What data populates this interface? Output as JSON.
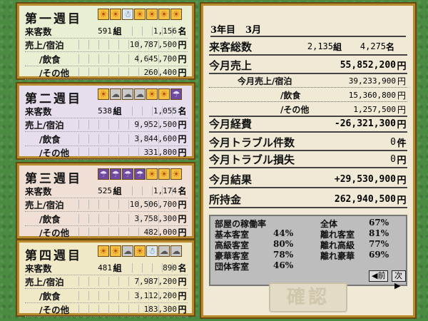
{
  "weeks": [
    {
      "title": "第一週目",
      "weather": [
        "sun",
        "sun",
        "snow",
        "sun",
        "sun",
        "sun",
        "sun"
      ],
      "rows": [
        [
          "来客数",
          "591",
          "組",
          "1,156",
          "名"
        ],
        [
          "売上/宿泊",
          "10,787,500",
          "円"
        ],
        [
          "/飲食",
          "4,645,700",
          "円"
        ],
        [
          "/その他",
          "260,400",
          "円"
        ]
      ]
    },
    {
      "title": "第二週目",
      "weather": [
        "sun",
        "cloud",
        "cloud",
        "cloud",
        "sun",
        "sun",
        "rain"
      ],
      "rows": [
        [
          "来客数",
          "538",
          "組",
          "1,055",
          "名"
        ],
        [
          "売上/宿泊",
          "9,952,500",
          "円"
        ],
        [
          "/飲食",
          "3,844,600",
          "円"
        ],
        [
          "/その他",
          "331,800",
          "円"
        ]
      ]
    },
    {
      "title": "第三週目",
      "weather": [
        "rain",
        "rain",
        "rain",
        "rain",
        "sun",
        "sun",
        "sun"
      ],
      "rows": [
        [
          "来客数",
          "525",
          "組",
          "1,174",
          "名"
        ],
        [
          "売上/宿泊",
          "10,506,700",
          "円"
        ],
        [
          "/飲食",
          "3,758,300",
          "円"
        ],
        [
          "/その他",
          "482,000",
          "円"
        ]
      ]
    },
    {
      "title": "第四週目",
      "weather": [
        "sun",
        "sun",
        "cloud",
        "sun",
        "snow",
        "cloud",
        "cloud"
      ],
      "rows": [
        [
          "来客数",
          "481",
          "組",
          "890",
          "名"
        ],
        [
          "売上/宿泊",
          "7,987,200",
          "円"
        ],
        [
          "/飲食",
          "3,112,200",
          "円"
        ],
        [
          "/その他",
          "183,300",
          "円"
        ]
      ]
    }
  ],
  "summary": {
    "year": "3年目",
    "month": "3月",
    "visitors_label": "来客総数",
    "visitors_groups": "2,135",
    "groups_unit": "組",
    "visitors_people": "4,275",
    "people_unit": "名",
    "sales_label": "今月売上",
    "sales": "55,852,200",
    "lodging_label": "今月売上/宿泊",
    "lodging": "39,233,900",
    "food_label": "/飲食",
    "food": "15,360,800",
    "other_label": "/その他",
    "other": "1,257,500",
    "expense_label": "今月経費",
    "expense": "-26,321,300",
    "trouble_count_label": "今月トラブル件数",
    "trouble_count": "0",
    "count_unit": "件",
    "trouble_loss_label": "今月トラブル損失",
    "trouble_loss": "0",
    "result_label": "今月結果",
    "result": "+29,530,900",
    "funds_label": "所持金",
    "funds": "262,940,500",
    "yen": "円"
  },
  "occupancy": {
    "title": "部屋の稼働率",
    "overall_label": "全体",
    "overall": "67%",
    "basic_label": "基本客室",
    "basic": "44%",
    "premium_label": "高級客室",
    "premium": "80%",
    "luxury_label": "豪華客室",
    "luxury": "78%",
    "group_label": "団体客室",
    "group": "46%",
    "annex_label": "離れ客室",
    "annex": "81%",
    "annex_premium_label": "離れ高級",
    "annex_premium": "77%",
    "annex_luxury_label": "離れ豪華",
    "annex_luxury": "69%",
    "prev": "◀前",
    "next": "次▶"
  },
  "confirm_label": "確認",
  "colors": {
    "week1": "#e9efd3",
    "week2": "#e6dded",
    "week3": "#f0dfd4",
    "week4": "#efe9c8",
    "frame": "#b88a2c"
  }
}
